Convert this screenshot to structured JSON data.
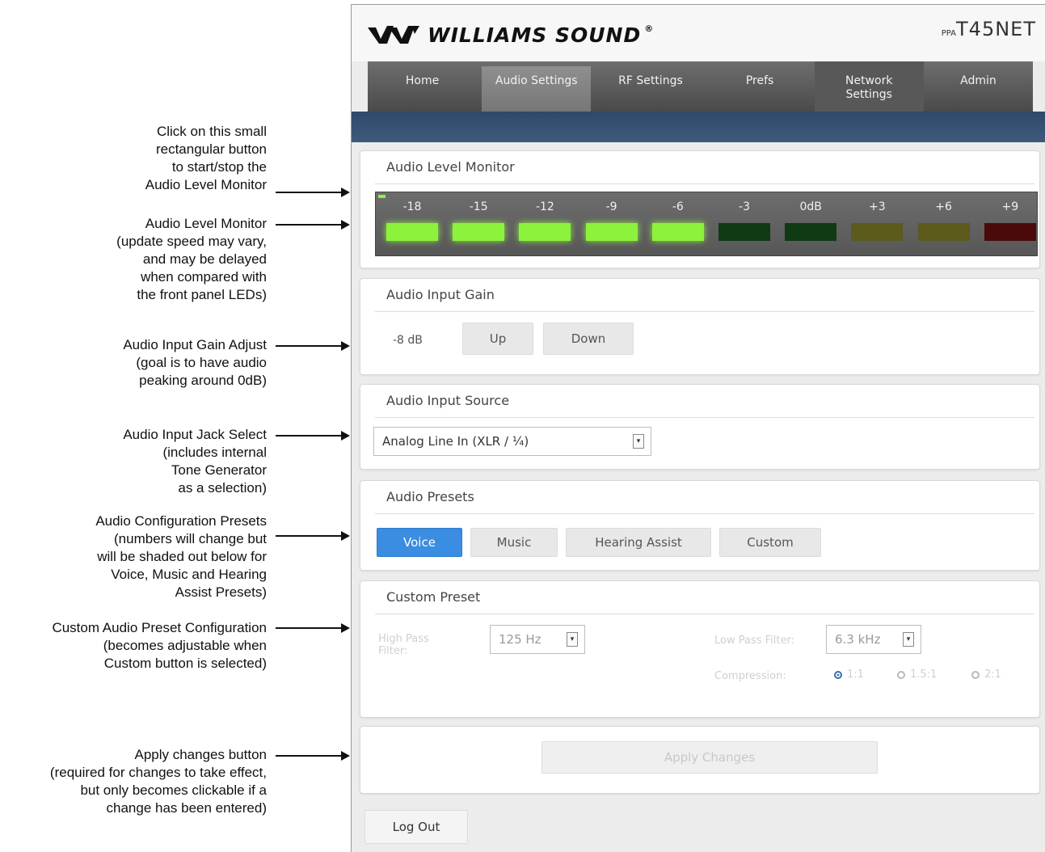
{
  "annotations": [
    {
      "lines": [
        "Click on this small",
        "rectangular button",
        "to start/stop the",
        "Audio Level Monitor"
      ]
    },
    {
      "lines": [
        "Audio Level Monitor",
        "(update speed may vary,",
        "and may be delayed",
        "when compared with",
        "the front panel LEDs)"
      ]
    },
    {
      "lines": [
        "Audio Input Gain Adjust",
        "(goal is to have audio",
        "peaking around 0dB)"
      ]
    },
    {
      "lines": [
        "Audio Input Jack Select",
        "(includes internal",
        "Tone Generator",
        "as a selection)"
      ]
    },
    {
      "lines": [
        "Audio Configuration Presets",
        "(numbers will change but",
        "will be shaded out below for",
        "Voice, Music and Hearing",
        "Assist Presets)"
      ]
    },
    {
      "lines": [
        "Custom Audio Preset Configuration",
        "(becomes adjustable when",
        "Custom button is selected)"
      ]
    },
    {
      "lines": [
        "Apply changes button",
        "(required for changes to take effect,",
        "but only becomes clickable if a",
        "change has been entered)"
      ]
    }
  ],
  "brand": {
    "logo_text": "WILLIAMS SOUND",
    "reg": "®",
    "model_prefix": "PPA",
    "model": "T45NET"
  },
  "nav": {
    "home": "Home",
    "audio": "Audio Settings",
    "rf": "RF Settings",
    "prefs": "Prefs",
    "network_1": "Network",
    "network_2": "Settings",
    "admin": "Admin"
  },
  "level_monitor": {
    "title": "Audio Level Monitor",
    "labels": [
      "-18",
      "-15",
      "-12",
      "-9",
      "-6",
      "-3",
      "0dB",
      "+3",
      "+6",
      "+9"
    ],
    "lit_count": 5,
    "colors": {
      "on": "#8cf23c",
      "off_green": "#0f3a14",
      "off_yellow": "#5c5a1c",
      "off_red": "#4a0a0a"
    }
  },
  "input_gain": {
    "title": "Audio Input Gain",
    "value": "-8 dB",
    "up": "Up",
    "down": "Down"
  },
  "input_source": {
    "title": "Audio Input Source",
    "selected": "Analog Line In (XLR / ¼)"
  },
  "presets": {
    "title": "Audio Presets",
    "voice": "Voice",
    "music": "Music",
    "hearing": "Hearing Assist",
    "custom": "Custom",
    "active": "Voice"
  },
  "custom_preset": {
    "title": "Custom Preset",
    "hp_label_1": "High Pass",
    "hp_label_2": "Filter:",
    "hp_value": "125 Hz",
    "lp_label": "Low Pass Filter:",
    "lp_value": "6.3 kHz",
    "compression_label": "Compression:",
    "ratio_1": "1:1",
    "ratio_2": "1.5:1",
    "ratio_3": "2:1",
    "selected_ratio": "1:1"
  },
  "apply": {
    "label": "Apply Changes"
  },
  "logout": {
    "label": "Log Out"
  }
}
